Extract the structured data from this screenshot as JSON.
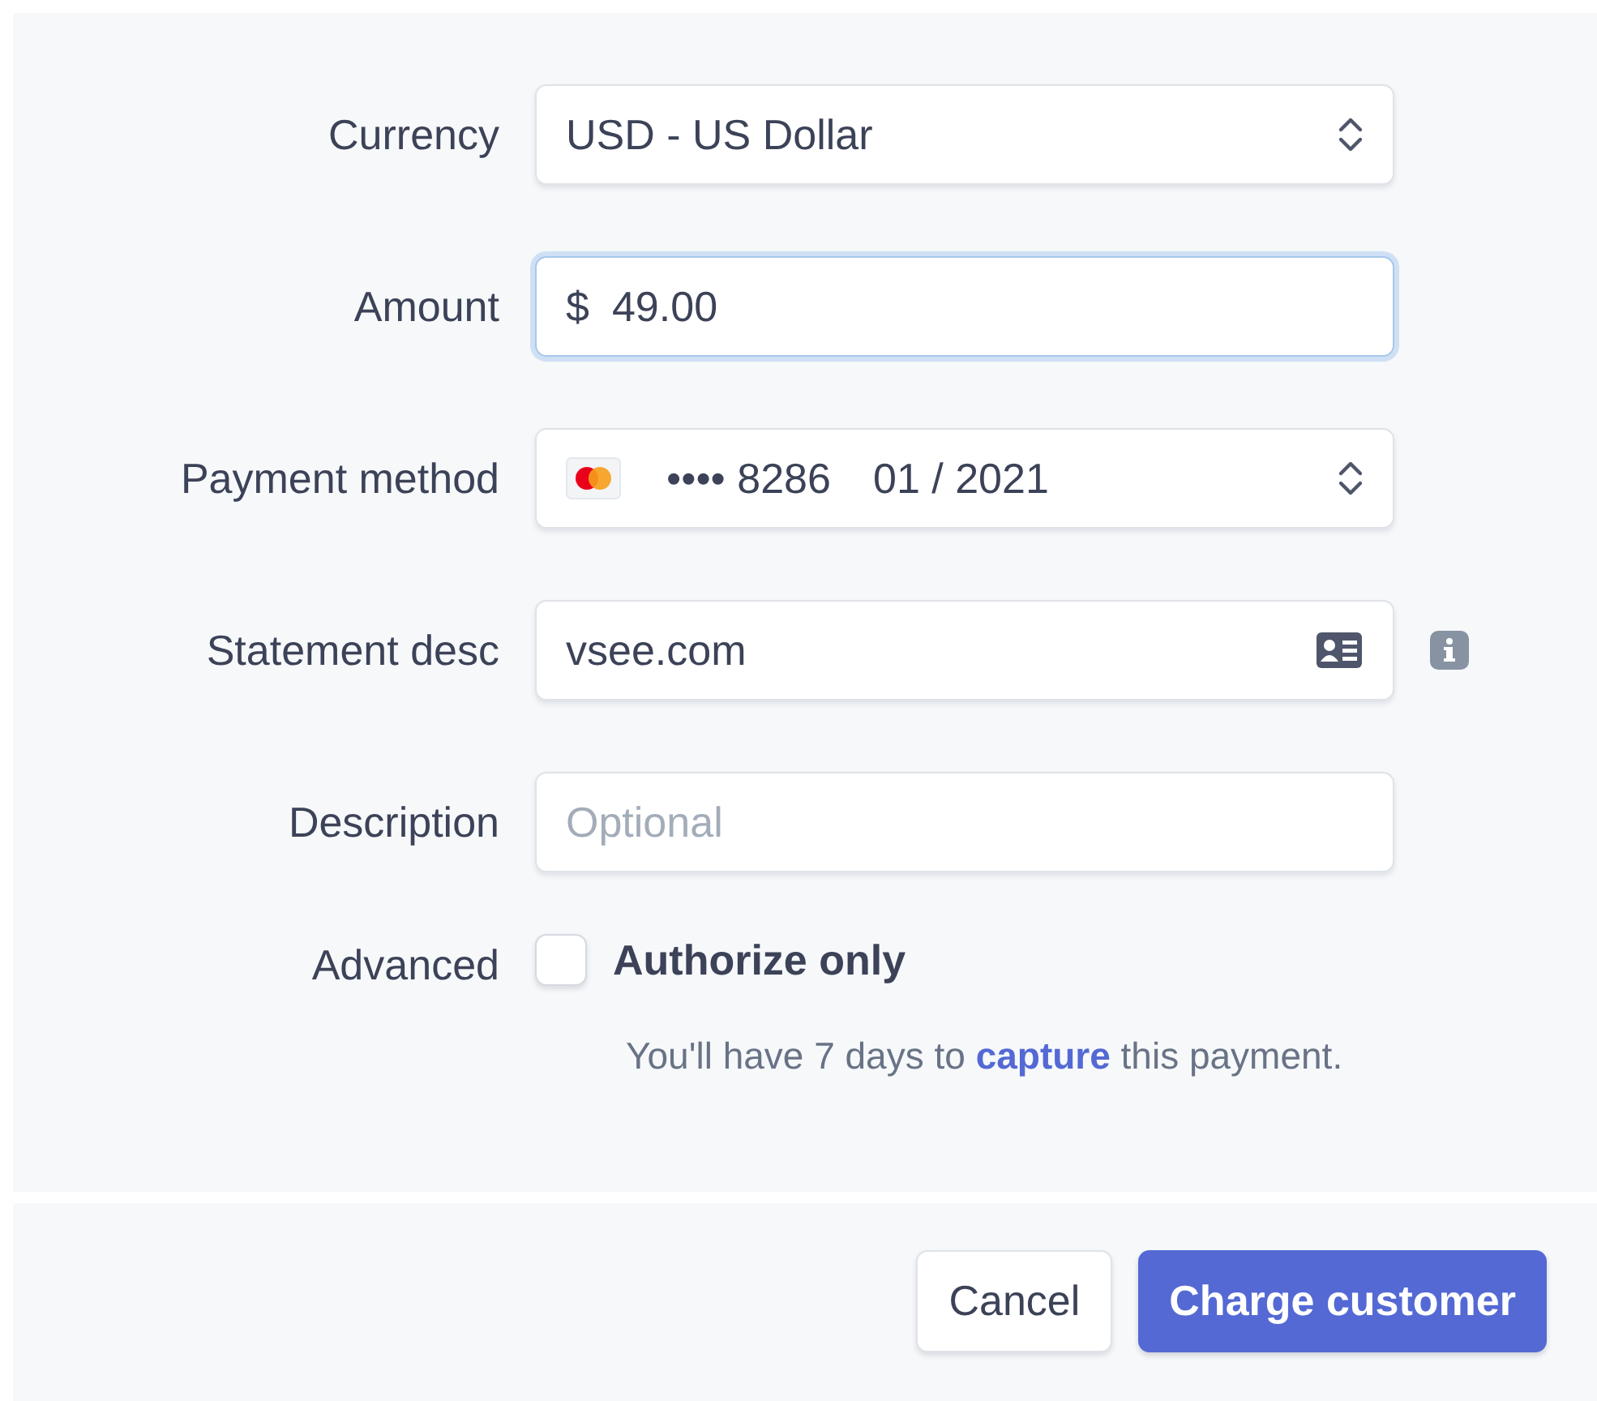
{
  "fields": [
    {
      "kind": "select",
      "label": "Currency",
      "value": "USD - US Dollar"
    },
    {
      "kind": "input",
      "label": "Amount",
      "prefix": "$",
      "value": "49.00",
      "focused": true
    },
    {
      "kind": "card",
      "label": "Payment method",
      "masked": "•••• 8286",
      "expiry": "01 / 2021"
    },
    {
      "kind": "input",
      "label": "Statement desc",
      "value": "vsee.com",
      "focused": false,
      "contact_icon": true,
      "info": true
    },
    {
      "kind": "input",
      "label": "Description",
      "placeholder": "Optional",
      "focused": false
    },
    {
      "kind": "checkbox",
      "label": "Advanced",
      "option": "Authorize only",
      "checked": false,
      "note_before": "You'll have 7 days to",
      "note_link": "capture",
      "note_after": "this payment."
    }
  ],
  "buttons": [
    {
      "label": "Cancel",
      "kind": "secondary"
    },
    {
      "label": "Charge customer",
      "kind": "primary"
    }
  ]
}
